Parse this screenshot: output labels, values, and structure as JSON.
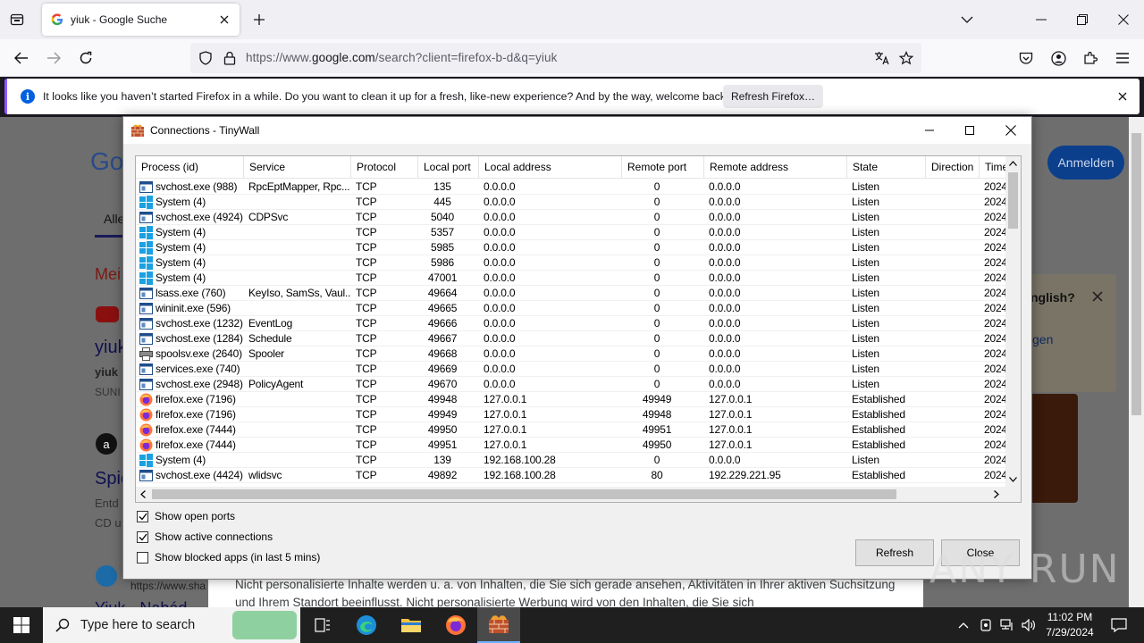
{
  "browser": {
    "tab_title": "yiuk - Google Suche",
    "url_prefix": "https://www.",
    "url_host": "google.com",
    "url_rest": "/search?client=firefox-b-d&q=yiuk",
    "notification": {
      "text": "It looks like you haven’t started Firefox in a while. Do you want to clean it up for a fresh, like-new experience? And by the way, welcome back!",
      "button": "Refresh Firefox…"
    }
  },
  "google_page": {
    "logo_fragment": "Go",
    "signin": "Anmelden",
    "tab_all": "Alle",
    "section_heading": "Mei",
    "result1_title": "yiuk",
    "result1_sub": "yiuk",
    "result1_meta": "SUNI",
    "result2_title": "Spie",
    "result2_line1": "Entd",
    "result2_line2": "CD u",
    "result3_url": "https://www.sha",
    "result3_title": "Yiuk - Nabád",
    "lang_prompt": "nglish?",
    "lang_link": "gen",
    "consent_text": "Nicht personalisierte Inhalte werden u. a. von Inhalten, die Sie sich gerade ansehen, Aktivitäten in Ihrer aktiven Suchsitzung und Ihrem Standort beeinflusst. Nicht personalisierte Werbung wird von den Inhalten, die Sie sich"
  },
  "tinywall": {
    "title": "Connections - TinyWall",
    "columns": [
      "Process (id)",
      "Service",
      "Protocol",
      "Local port",
      "Local address",
      "Remote port",
      "Remote address",
      "State",
      "Direction",
      "Time"
    ],
    "rows": [
      {
        "icon": "svchost",
        "process": "svchost.exe (988)",
        "service": "RpcEptMapper, Rpc...",
        "protocol": "TCP",
        "lport": "135",
        "laddr": "0.0.0.0",
        "rport": "0",
        "raddr": "0.0.0.0",
        "state": "Listen",
        "direction": "",
        "time": "2024"
      },
      {
        "icon": "windows",
        "process": "System (4)",
        "service": "",
        "protocol": "TCP",
        "lport": "445",
        "laddr": "0.0.0.0",
        "rport": "0",
        "raddr": "0.0.0.0",
        "state": "Listen",
        "direction": "",
        "time": "2024"
      },
      {
        "icon": "svchost",
        "process": "svchost.exe (4924)",
        "service": "CDPSvc",
        "protocol": "TCP",
        "lport": "5040",
        "laddr": "0.0.0.0",
        "rport": "0",
        "raddr": "0.0.0.0",
        "state": "Listen",
        "direction": "",
        "time": "2024"
      },
      {
        "icon": "windows",
        "process": "System (4)",
        "service": "",
        "protocol": "TCP",
        "lport": "5357",
        "laddr": "0.0.0.0",
        "rport": "0",
        "raddr": "0.0.0.0",
        "state": "Listen",
        "direction": "",
        "time": "2024"
      },
      {
        "icon": "windows",
        "process": "System (4)",
        "service": "",
        "protocol": "TCP",
        "lport": "5985",
        "laddr": "0.0.0.0",
        "rport": "0",
        "raddr": "0.0.0.0",
        "state": "Listen",
        "direction": "",
        "time": "2024"
      },
      {
        "icon": "windows",
        "process": "System (4)",
        "service": "",
        "protocol": "TCP",
        "lport": "5986",
        "laddr": "0.0.0.0",
        "rport": "0",
        "raddr": "0.0.0.0",
        "state": "Listen",
        "direction": "",
        "time": "2024"
      },
      {
        "icon": "windows",
        "process": "System (4)",
        "service": "",
        "protocol": "TCP",
        "lport": "47001",
        "laddr": "0.0.0.0",
        "rport": "0",
        "raddr": "0.0.0.0",
        "state": "Listen",
        "direction": "",
        "time": "2024"
      },
      {
        "icon": "svchost",
        "process": "lsass.exe (760)",
        "service": "KeyIso, SamSs, Vaul...",
        "protocol": "TCP",
        "lport": "49664",
        "laddr": "0.0.0.0",
        "rport": "0",
        "raddr": "0.0.0.0",
        "state": "Listen",
        "direction": "",
        "time": "2024"
      },
      {
        "icon": "svchost",
        "process": "wininit.exe (596)",
        "service": "",
        "protocol": "TCP",
        "lport": "49665",
        "laddr": "0.0.0.0",
        "rport": "0",
        "raddr": "0.0.0.0",
        "state": "Listen",
        "direction": "",
        "time": "2024"
      },
      {
        "icon": "svchost",
        "process": "svchost.exe (1232)",
        "service": "EventLog",
        "protocol": "TCP",
        "lport": "49666",
        "laddr": "0.0.0.0",
        "rport": "0",
        "raddr": "0.0.0.0",
        "state": "Listen",
        "direction": "",
        "time": "2024"
      },
      {
        "icon": "svchost",
        "process": "svchost.exe (1284)",
        "service": "Schedule",
        "protocol": "TCP",
        "lport": "49667",
        "laddr": "0.0.0.0",
        "rport": "0",
        "raddr": "0.0.0.0",
        "state": "Listen",
        "direction": "",
        "time": "2024"
      },
      {
        "icon": "printer",
        "process": "spoolsv.exe (2640)",
        "service": "Spooler",
        "protocol": "TCP",
        "lport": "49668",
        "laddr": "0.0.0.0",
        "rport": "0",
        "raddr": "0.0.0.0",
        "state": "Listen",
        "direction": "",
        "time": "2024"
      },
      {
        "icon": "svchost",
        "process": "services.exe (740)",
        "service": "",
        "protocol": "TCP",
        "lport": "49669",
        "laddr": "0.0.0.0",
        "rport": "0",
        "raddr": "0.0.0.0",
        "state": "Listen",
        "direction": "",
        "time": "2024"
      },
      {
        "icon": "svchost",
        "process": "svchost.exe (2948)",
        "service": "PolicyAgent",
        "protocol": "TCP",
        "lport": "49670",
        "laddr": "0.0.0.0",
        "rport": "0",
        "raddr": "0.0.0.0",
        "state": "Listen",
        "direction": "",
        "time": "2024"
      },
      {
        "icon": "firefox",
        "process": "firefox.exe (7196)",
        "service": "",
        "protocol": "TCP",
        "lport": "49948",
        "laddr": "127.0.0.1",
        "rport": "49949",
        "raddr": "127.0.0.1",
        "state": "Established",
        "direction": "",
        "time": "2024"
      },
      {
        "icon": "firefox",
        "process": "firefox.exe (7196)",
        "service": "",
        "protocol": "TCP",
        "lport": "49949",
        "laddr": "127.0.0.1",
        "rport": "49948",
        "raddr": "127.0.0.1",
        "state": "Established",
        "direction": "",
        "time": "2024"
      },
      {
        "icon": "firefox",
        "process": "firefox.exe (7444)",
        "service": "",
        "protocol": "TCP",
        "lport": "49950",
        "laddr": "127.0.0.1",
        "rport": "49951",
        "raddr": "127.0.0.1",
        "state": "Established",
        "direction": "",
        "time": "2024"
      },
      {
        "icon": "firefox",
        "process": "firefox.exe (7444)",
        "service": "",
        "protocol": "TCP",
        "lport": "49951",
        "laddr": "127.0.0.1",
        "rport": "49950",
        "raddr": "127.0.0.1",
        "state": "Established",
        "direction": "",
        "time": "2024"
      },
      {
        "icon": "windows",
        "process": "System (4)",
        "service": "",
        "protocol": "TCP",
        "lport": "139",
        "laddr": "192.168.100.28",
        "rport": "0",
        "raddr": "0.0.0.0",
        "state": "Listen",
        "direction": "",
        "time": "2024"
      },
      {
        "icon": "svchost",
        "process": "svchost.exe (4424)",
        "service": "wlidsvc",
        "protocol": "TCP",
        "lport": "49892",
        "laddr": "192.168.100.28",
        "rport": "80",
        "raddr": "192.229.221.95",
        "state": "Established",
        "direction": "",
        "time": "2024"
      }
    ],
    "checkboxes": [
      {
        "label": "Show open ports",
        "checked": true
      },
      {
        "label": "Show active connections",
        "checked": true
      },
      {
        "label": "Show blocked apps (in last 5 mins)",
        "checked": false
      }
    ],
    "refresh_button": "Refresh",
    "close_button": "Close"
  },
  "taskbar": {
    "search_placeholder": "Type here to search",
    "time": "11:02 PM",
    "date": "7/29/2024"
  },
  "watermark": "ANY RUN"
}
